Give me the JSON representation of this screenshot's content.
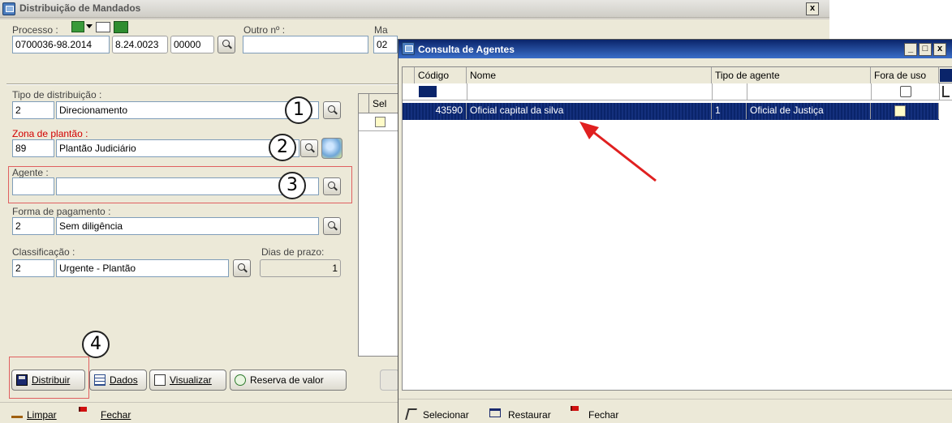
{
  "main_window": {
    "title": "Distribuição de Mandados",
    "close_glyph": "x",
    "processo_label": "Processo :",
    "processo_part1": "0700036-98.2014",
    "processo_part2": "8.24.0023",
    "processo_part3": "00000",
    "outro_label": "Outro nº :",
    "outro_value": "",
    "ma_label": "Ma",
    "ma_value": "02",
    "tipo_label": "Tipo de distribuição :",
    "tipo_code": "2",
    "tipo_value": "Direcionamento",
    "zona_label": "Zona de plantão :",
    "zona_code": "89",
    "zona_value": "Plantão Judiciário",
    "agente_label": "Agente :",
    "agente_code": "",
    "agente_value": "",
    "forma_label": "Forma de pagamento :",
    "forma_code": "2",
    "forma_value": "Sem diligência",
    "classif_label": "Classificação :",
    "classif_code": "2",
    "classif_value": "Urgente - Plantão",
    "dias_label": "Dias de prazo:",
    "dias_value": "1",
    "sel_header": "Sel",
    "buttons": {
      "distribuir": "Distribuir",
      "dados": "Dados",
      "visualizar": "Visualizar",
      "reserva": "Reserva de valor"
    },
    "bottom": {
      "limpar": "Limpar",
      "fechar": "Fechar"
    },
    "callouts": [
      "1",
      "2",
      "3",
      "4"
    ]
  },
  "consulta_window": {
    "title": "Consulta de Agentes",
    "columns": [
      "Código",
      "Nome",
      "Tipo de agente",
      "Fora de uso"
    ],
    "row": {
      "codigo": "43590",
      "nome": "Oficial capital da silva",
      "tipo_code": "1",
      "tipo_nome": "Oficial de Justiça"
    },
    "toolbar": {
      "selecionar": "Selecionar",
      "restaurar": "Restaurar",
      "fechar": "Fechar"
    }
  },
  "colors": {
    "accent": "#0a246a",
    "selection": "#0a246a",
    "callout_border": "#e06060",
    "arrow": "#e02020"
  },
  "icons": [
    "search-icon",
    "save-icon",
    "form-icon",
    "preview-icon",
    "dollar-icon",
    "broom-icon",
    "flag-icon",
    "select-icon",
    "restore-icon",
    "filter-icon",
    "globe-icon"
  ]
}
